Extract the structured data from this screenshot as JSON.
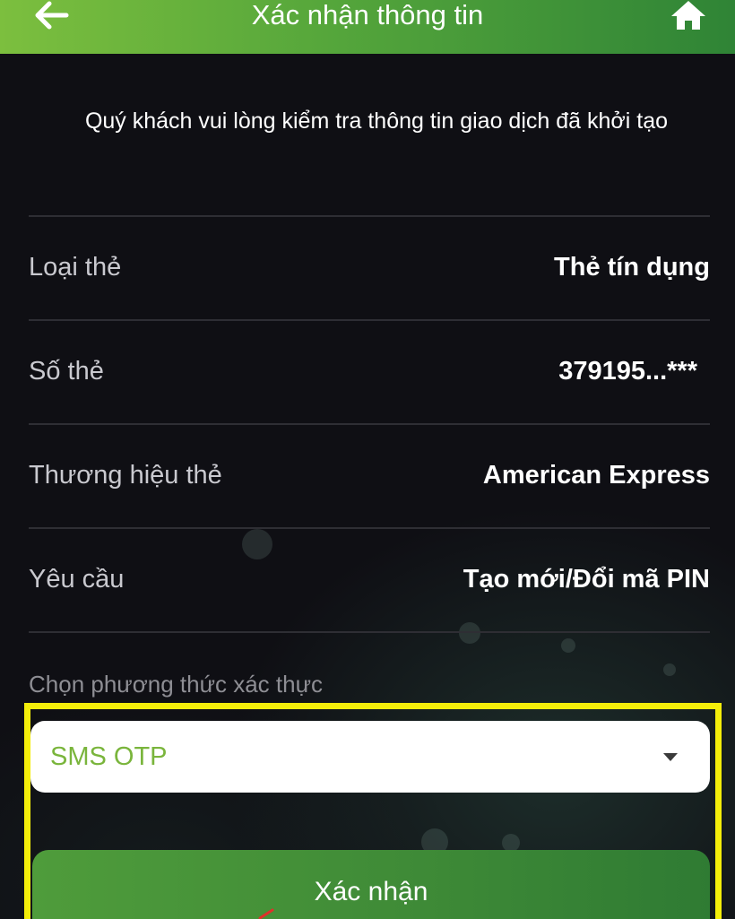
{
  "header": {
    "title": "Xác nhận thông tin",
    "back_icon": "arrow-left-icon",
    "home_icon": "home-icon"
  },
  "intro_text": "Quý khách vui lòng kiểm tra thông tin giao dịch đã khởi tạo",
  "details": [
    {
      "label": "Loại thẻ",
      "value": "Thẻ tín dụng"
    },
    {
      "label": "Số thẻ",
      "value": "379195...***"
    },
    {
      "label": "Thương hiệu thẻ",
      "value": "American Express"
    },
    {
      "label": "Yêu cầu",
      "value": "Tạo mới/Đổi mã PIN"
    }
  ],
  "auth": {
    "label": "Chọn phương thức xác thực",
    "selected": "SMS OTP"
  },
  "confirm_label": "Xác nhận",
  "colors": {
    "header_gradient_start": "#7cbf3e",
    "header_gradient_end": "#2f8436",
    "accent_green": "#7ab53c",
    "highlight_yellow": "#f4ee0a",
    "button_green": "#3f8b37"
  }
}
